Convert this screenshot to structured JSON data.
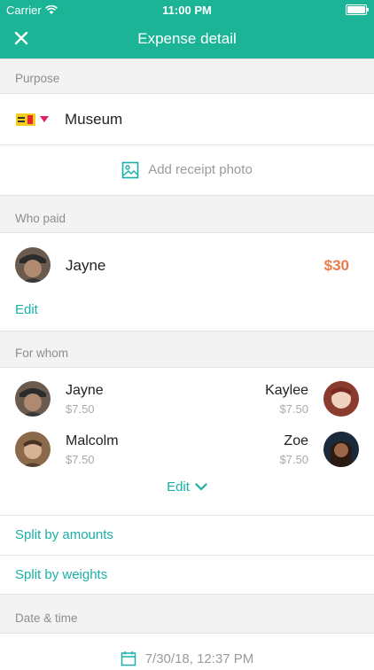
{
  "status_bar": {
    "carrier": "Carrier",
    "time": "11:00 PM"
  },
  "nav": {
    "title": "Expense detail",
    "close_icon": "close-icon"
  },
  "sections": {
    "purpose": "Purpose",
    "who_paid": "Who paid",
    "for_whom": "For whom",
    "date_time": "Date & time"
  },
  "purpose": {
    "text": "Museum",
    "receipt_label": "Add receipt photo"
  },
  "payer": {
    "name": "Jayne",
    "amount": "$30",
    "edit_label": "Edit"
  },
  "participants": [
    {
      "name": "Jayne",
      "share": "$7.50"
    },
    {
      "name": "Kaylee",
      "share": "$7.50"
    },
    {
      "name": "Malcolm",
      "share": "$7.50"
    },
    {
      "name": "Zoe",
      "share": "$7.50"
    }
  ],
  "for_whom_edit": "Edit",
  "split": {
    "amounts": "Split by amounts",
    "weights": "Split by weights"
  },
  "date": {
    "value": "7/30/18, 12:37 PM"
  },
  "colors": {
    "header": "#1cb497",
    "accent": "#1ab0a8",
    "amount": "#ee7a4c",
    "caret": "#e0245e"
  }
}
